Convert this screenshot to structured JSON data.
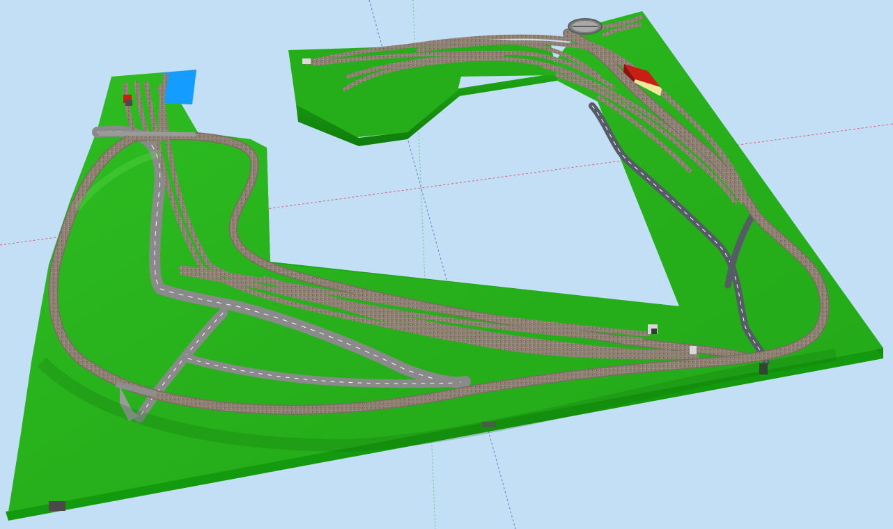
{
  "app": {
    "view": "3d-layout-viewport"
  },
  "colors": {
    "sky": "#c3dff6",
    "grass_top": "#27b21b",
    "grass_light": "#35c426",
    "grass_side": "#179a10",
    "grass_side_dark": "#0f7a0a",
    "ballast": "#8f8073",
    "ballast_dark": "#6f6259",
    "road": "#8e8e8e",
    "road_dark": "#5f6470",
    "road_mark": "#ffffff",
    "water": "#149dff",
    "roof_red": "#c81e14",
    "wall_yellow": "#ecea9a",
    "axis_red": "#e04040",
    "axis_green": "#30c030",
    "axis_blue": "#3050c0"
  },
  "scene": {
    "objects": [
      {
        "name": "baseboard-main",
        "kind": "terrain"
      },
      {
        "name": "baseboard-upper-right",
        "kind": "terrain"
      },
      {
        "name": "lake",
        "kind": "water"
      },
      {
        "name": "turntable",
        "kind": "structure"
      },
      {
        "name": "engine-shed",
        "kind": "building"
      },
      {
        "name": "small-station-building",
        "kind": "building"
      },
      {
        "name": "main-oval-track",
        "kind": "track"
      },
      {
        "name": "yard-tracks",
        "kind": "track"
      },
      {
        "name": "left-road",
        "kind": "road"
      },
      {
        "name": "right-road",
        "kind": "road"
      },
      {
        "name": "road-bridge",
        "kind": "bridge"
      },
      {
        "name": "tunnel-portals",
        "kind": "structure"
      }
    ]
  }
}
